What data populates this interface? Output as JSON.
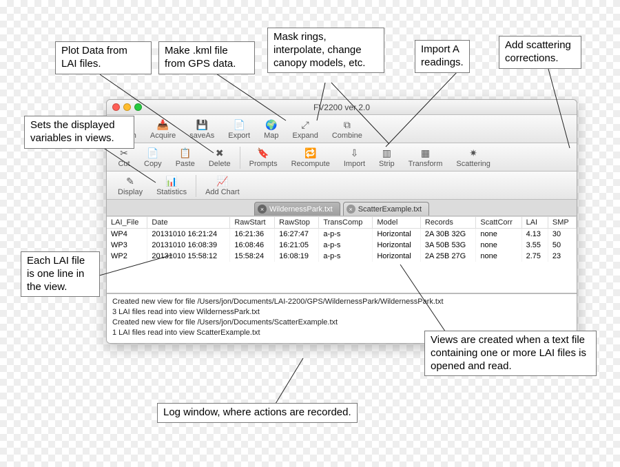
{
  "window": {
    "title": "FV2200 ver 2.0"
  },
  "toolbar": {
    "row1": [
      {
        "id": "open",
        "label": "Open",
        "glyph": "📂"
      },
      {
        "id": "acquire",
        "label": "Acquire",
        "glyph": "📥"
      },
      {
        "id": "saveas",
        "label": "saveAs",
        "glyph": "💾"
      },
      {
        "id": "export",
        "label": "Export",
        "glyph": "📄"
      },
      {
        "id": "map",
        "label": "Map",
        "glyph": "🌍"
      },
      {
        "id": "expand",
        "label": "Expand",
        "glyph": "⤢"
      },
      {
        "id": "combine",
        "label": "Combine",
        "glyph": "⧉"
      }
    ],
    "row2": [
      {
        "id": "cut",
        "label": "Cut",
        "glyph": "✂"
      },
      {
        "id": "copy",
        "label": "Copy",
        "glyph": "📄"
      },
      {
        "id": "paste",
        "label": "Paste",
        "glyph": "📋"
      },
      {
        "id": "delete",
        "label": "Delete",
        "glyph": "✖"
      },
      {
        "__sep": true
      },
      {
        "id": "prompts",
        "label": "Prompts",
        "glyph": "🔖"
      },
      {
        "id": "recompute",
        "label": "Recompute",
        "glyph": "🔁"
      },
      {
        "id": "import",
        "label": "Import",
        "glyph": "⇩"
      },
      {
        "id": "strip",
        "label": "Strip",
        "glyph": "▥"
      },
      {
        "id": "transform",
        "label": "Transform",
        "glyph": "▦"
      },
      {
        "id": "scattering",
        "label": "Scattering",
        "glyph": "✷"
      }
    ],
    "row3": [
      {
        "id": "display",
        "label": "Display",
        "glyph": "✎"
      },
      {
        "id": "statistics",
        "label": "Statistics",
        "glyph": "📊"
      },
      {
        "__sep": true
      },
      {
        "id": "addchart",
        "label": "Add Chart",
        "glyph": "📈"
      }
    ]
  },
  "tabs": [
    {
      "label": "WildernessPark.txt",
      "active": true
    },
    {
      "label": "ScatterExample.txt",
      "active": false
    }
  ],
  "table": {
    "columns": [
      "LAI_File",
      "Date",
      "RawStart",
      "RawStop",
      "TransComp",
      "Model",
      "Records",
      "ScattCorr",
      "LAI",
      "SMP"
    ],
    "rows": [
      {
        "LAI_File": "WP4",
        "Date": "20131010 16:21:24",
        "RawStart": "16:21:36",
        "RawStop": "16:27:47",
        "TransComp": "a-p-s",
        "Model": "Horizontal",
        "Records": "2A 30B 32G",
        "ScattCorr": "none",
        "LAI": "4.13",
        "SMP": "30"
      },
      {
        "LAI_File": "WP3",
        "Date": "20131010 16:08:39",
        "RawStart": "16:08:46",
        "RawStop": "16:21:05",
        "TransComp": "a-p-s",
        "Model": "Horizontal",
        "Records": "3A 50B 53G",
        "ScattCorr": "none",
        "LAI": "3.55",
        "SMP": "50"
      },
      {
        "LAI_File": "WP2",
        "Date": "20131010 15:58:12",
        "RawStart": "15:58:24",
        "RawStop": "16:08:19",
        "TransComp": "a-p-s",
        "Model": "Horizontal",
        "Records": "2A 25B 27G",
        "ScattCorr": "none",
        "LAI": "2.75",
        "SMP": "23"
      }
    ]
  },
  "log": [
    "Created new view for file /Users/jon/Documents/LAI-2200/GPS/WildernessPark/WildernessPark.txt",
    "3 LAI files read into view WildernessPark.txt",
    "Created new view for file /Users/jon/Documents/ScatterExample.txt",
    "1 LAI files read into view ScatterExample.txt"
  ],
  "callouts": {
    "plot": "Plot Data from LAI files.",
    "kml": "Make .kml file from GPS data.",
    "mask": "Mask rings, interpolate, change canopy models, etc.",
    "import": "Import A readings.",
    "scatter": "Add scattering corrections.",
    "display": "Sets the displayed variables in views.",
    "row": "Each LAI file is one line in the view.",
    "views": "Views are created when a text file containing one or more LAI files is opened and read.",
    "log": "Log window, where actions are recorded."
  }
}
